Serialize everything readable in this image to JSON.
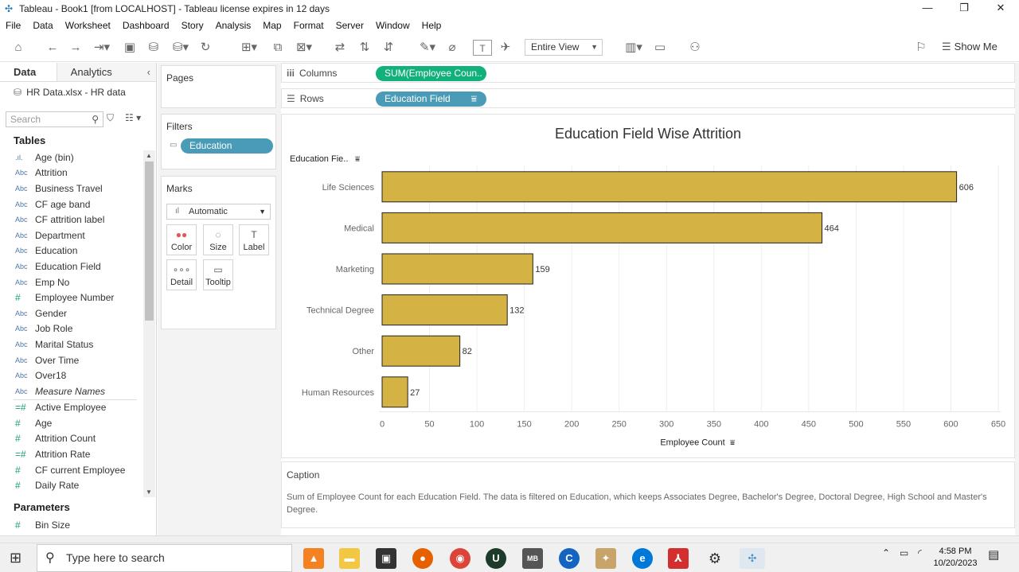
{
  "window": {
    "title": "Tableau - Book1 [from LOCALHOST] - Tableau license expires in 12 days"
  },
  "menu": [
    "File",
    "Data",
    "Worksheet",
    "Dashboard",
    "Story",
    "Analysis",
    "Map",
    "Format",
    "Server",
    "Window",
    "Help"
  ],
  "toolbar": {
    "fit": "Entire View",
    "show_me": "Show Me"
  },
  "data_pane": {
    "tab_data": "Data",
    "tab_analytics": "Analytics",
    "source": "HR Data.xlsx - HR data",
    "search_placeholder": "Search",
    "tables_heading": "Tables",
    "dimensions": [
      {
        "icon": ".ıl.",
        "name": "Age (bin)"
      },
      {
        "icon": "Abc",
        "name": "Attrition"
      },
      {
        "icon": "Abc",
        "name": "Business Travel"
      },
      {
        "icon": "Abc",
        "name": "CF age band"
      },
      {
        "icon": "Abc",
        "name": "CF attrition label"
      },
      {
        "icon": "Abc",
        "name": "Department"
      },
      {
        "icon": "Abc",
        "name": "Education"
      },
      {
        "icon": "Abc",
        "name": "Education Field"
      },
      {
        "icon": "Abc",
        "name": "Emp No"
      },
      {
        "icon": "#",
        "name": "Employee Number"
      },
      {
        "icon": "Abc",
        "name": "Gender"
      },
      {
        "icon": "Abc",
        "name": "Job Role"
      },
      {
        "icon": "Abc",
        "name": "Marital Status"
      },
      {
        "icon": "Abc",
        "name": "Over Time"
      },
      {
        "icon": "Abc",
        "name": "Over18"
      },
      {
        "icon": "Abc",
        "name": "Measure Names"
      }
    ],
    "measures": [
      {
        "icon": "=#",
        "name": "Active Employee"
      },
      {
        "icon": "#",
        "name": "Age"
      },
      {
        "icon": "#",
        "name": "Attrition Count"
      },
      {
        "icon": "=#",
        "name": "Attrition Rate"
      },
      {
        "icon": "#",
        "name": "CF current Employee"
      },
      {
        "icon": "#",
        "name": "Daily Rate"
      }
    ],
    "parameters_heading": "Parameters",
    "parameters": [
      {
        "icon": "#",
        "name": "Bin Size"
      }
    ]
  },
  "cards": {
    "pages": "Pages",
    "filters": "Filters",
    "filter_pill": "Education",
    "marks": "Marks",
    "mark_type": "Automatic",
    "mark_buttons": [
      {
        "icon": "●●",
        "label": "Color"
      },
      {
        "icon": "◌",
        "label": "Size"
      },
      {
        "icon": "T",
        "label": "Label"
      },
      {
        "icon": "∘∘∘",
        "label": "Detail"
      },
      {
        "icon": "▭",
        "label": "Tooltip"
      }
    ]
  },
  "shelves": {
    "columns_label": "Columns",
    "columns_pill": "SUM(Employee Coun..",
    "rows_label": "Rows",
    "rows_pill": "Education Field"
  },
  "chart_data": {
    "type": "bar",
    "orientation": "horizontal",
    "title": "Education Field Wise Attrition",
    "ylabel": "Education Fie..",
    "xlabel": "Employee Count",
    "categories": [
      "Life Sciences",
      "Medical",
      "Marketing",
      "Technical Degree",
      "Other",
      "Human Resources"
    ],
    "values": [
      606,
      464,
      159,
      132,
      82,
      27
    ],
    "xlim": [
      0,
      650
    ],
    "xticks": [
      0,
      50,
      100,
      150,
      200,
      250,
      300,
      350,
      400,
      450,
      500,
      550,
      600,
      650
    ],
    "bar_color": "#d4b244",
    "grid": true
  },
  "caption": {
    "title": "Caption",
    "text": "Sum of Employee Count for each Education Field. The data is filtered on Education, which keeps Associates Degree, Bachelor's Degree, Doctoral Degree, High School and Master's Degree."
  },
  "taskbar": {
    "search_placeholder": "Type here to search",
    "time": "4:58 PM",
    "date": "10/20/2023"
  },
  "colors": {
    "dimension_pill": "#4a9bb7",
    "measure_pill": "#12b07b",
    "bar": "#d4b244"
  }
}
